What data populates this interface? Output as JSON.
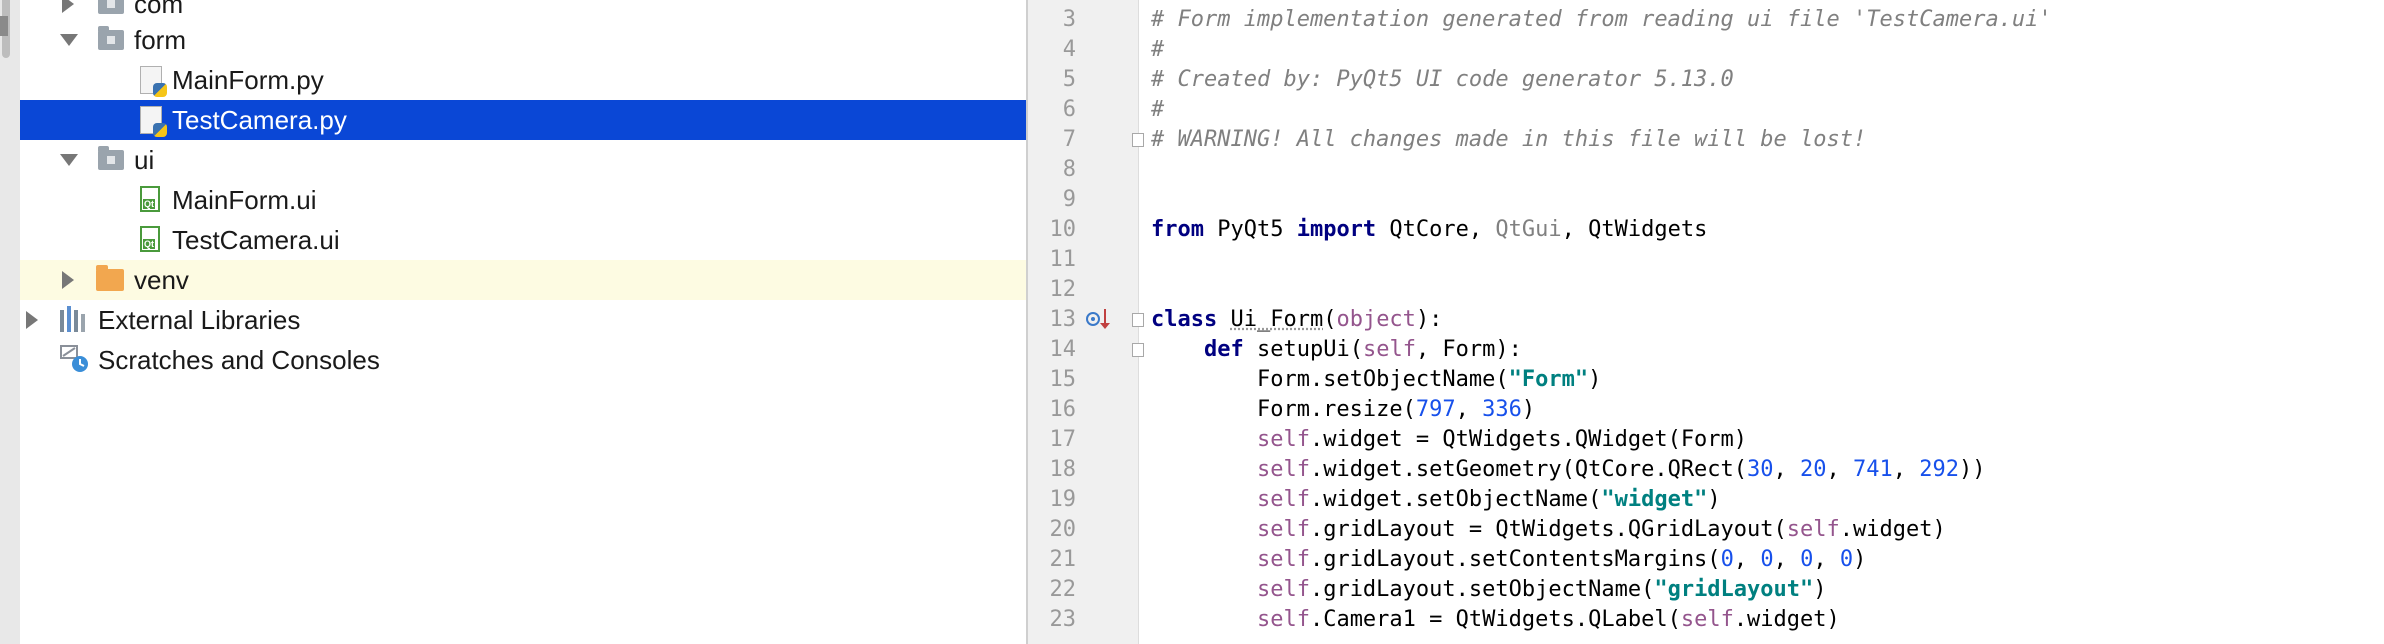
{
  "project_tree": {
    "rows": [
      {
        "id": "com",
        "label": "com",
        "type": "folder",
        "expanded": false
      },
      {
        "id": "form",
        "label": "form",
        "type": "folder",
        "expanded": true
      },
      {
        "id": "mainform-py",
        "label": "MainForm.py",
        "type": "python-file"
      },
      {
        "id": "testcamera-py",
        "label": "TestCamera.py",
        "type": "python-file",
        "selected": true
      },
      {
        "id": "ui",
        "label": "ui",
        "type": "folder",
        "expanded": true
      },
      {
        "id": "mainform-ui",
        "label": "MainForm.ui",
        "type": "qt-ui-file"
      },
      {
        "id": "testcamera-ui",
        "label": "TestCamera.ui",
        "type": "qt-ui-file"
      },
      {
        "id": "venv",
        "label": "venv",
        "type": "excluded-folder",
        "expanded": false
      },
      {
        "id": "external-libraries",
        "label": "External Libraries",
        "type": "libraries",
        "expanded": false
      },
      {
        "id": "scratches",
        "label": "Scratches and Consoles",
        "type": "scratches"
      }
    ]
  },
  "editor": {
    "lines": [
      {
        "n": "3",
        "tokens": [
          [
            "com",
            "# Form implementation generated from reading ui file 'TestCamera.ui'"
          ]
        ]
      },
      {
        "n": "4",
        "tokens": [
          [
            "com",
            "#"
          ]
        ]
      },
      {
        "n": "5",
        "tokens": [
          [
            "com",
            "# Created by: PyQt5 UI code generator 5.13.0"
          ]
        ]
      },
      {
        "n": "6",
        "tokens": [
          [
            "com",
            "#"
          ]
        ]
      },
      {
        "n": "7",
        "tokens": [
          [
            "com",
            "# WARNING! All changes made in this file will be lost!"
          ]
        ],
        "fold": true
      },
      {
        "n": "8",
        "tokens": []
      },
      {
        "n": "9",
        "tokens": []
      },
      {
        "n": "10",
        "tokens": [
          [
            "kw",
            "from"
          ],
          [
            "",
            " PyQt5 "
          ],
          [
            "kw",
            "import"
          ],
          [
            "",
            " QtCore, "
          ],
          [
            "gray",
            "QtGui"
          ],
          [
            "",
            ", QtWidgets"
          ]
        ]
      },
      {
        "n": "11",
        "tokens": []
      },
      {
        "n": "12",
        "tokens": []
      },
      {
        "n": "13",
        "tokens": [
          [
            "kw",
            "class"
          ],
          [
            "",
            " "
          ],
          [
            "und",
            "Ui_Form"
          ],
          [
            "",
            "("
          ],
          [
            "self",
            "object"
          ],
          [
            "",
            "):"
          ]
        ],
        "fold": true,
        "run": true
      },
      {
        "n": "14",
        "tokens": [
          [
            "",
            "    "
          ],
          [
            "kw",
            "def"
          ],
          [
            "",
            " setupUi("
          ],
          [
            "self",
            "self"
          ],
          [
            "",
            ", Form):"
          ]
        ],
        "fold": true
      },
      {
        "n": "15",
        "tokens": [
          [
            "",
            "        Form.setObjectName("
          ],
          [
            "str",
            "\"Form\""
          ],
          [
            "",
            ")"
          ]
        ]
      },
      {
        "n": "16",
        "tokens": [
          [
            "",
            "        Form.resize("
          ],
          [
            "num",
            "797"
          ],
          [
            "",
            ", "
          ],
          [
            "num",
            "336"
          ],
          [
            "",
            ")"
          ]
        ]
      },
      {
        "n": "17",
        "tokens": [
          [
            "",
            "        "
          ],
          [
            "self",
            "self"
          ],
          [
            "",
            ".widget = QtWidgets.QWidget(Form)"
          ]
        ]
      },
      {
        "n": "18",
        "tokens": [
          [
            "",
            "        "
          ],
          [
            "self",
            "self"
          ],
          [
            "",
            ".widget.setGeometry(QtCore.QRect("
          ],
          [
            "num",
            "30"
          ],
          [
            "",
            ", "
          ],
          [
            "num",
            "20"
          ],
          [
            "",
            ", "
          ],
          [
            "num",
            "741"
          ],
          [
            "",
            ", "
          ],
          [
            "num",
            "292"
          ],
          [
            "",
            "))"
          ]
        ]
      },
      {
        "n": "19",
        "tokens": [
          [
            "",
            "        "
          ],
          [
            "self",
            "self"
          ],
          [
            "",
            ".widget.setObjectName("
          ],
          [
            "str",
            "\"widget\""
          ],
          [
            "",
            ")"
          ]
        ]
      },
      {
        "n": "20",
        "tokens": [
          [
            "",
            "        "
          ],
          [
            "self",
            "self"
          ],
          [
            "",
            ".gridLayout = QtWidgets.QGridLayout("
          ],
          [
            "self",
            "self"
          ],
          [
            "",
            ".widget)"
          ]
        ]
      },
      {
        "n": "21",
        "tokens": [
          [
            "",
            "        "
          ],
          [
            "self",
            "self"
          ],
          [
            "",
            ".gridLayout.setContentsMargins("
          ],
          [
            "num",
            "0"
          ],
          [
            "",
            ", "
          ],
          [
            "num",
            "0"
          ],
          [
            "",
            ", "
          ],
          [
            "num",
            "0"
          ],
          [
            "",
            ", "
          ],
          [
            "num",
            "0"
          ],
          [
            "",
            ")"
          ]
        ]
      },
      {
        "n": "22",
        "tokens": [
          [
            "",
            "        "
          ],
          [
            "self",
            "self"
          ],
          [
            "",
            ".gridLayout.setObjectName("
          ],
          [
            "str",
            "\"gridLayout\""
          ],
          [
            "",
            ")"
          ]
        ]
      },
      {
        "n": "23",
        "tokens": [
          [
            "",
            "        "
          ],
          [
            "self",
            "self"
          ],
          [
            "",
            ".Camera1 = QtWidgets.QLabel("
          ],
          [
            "self",
            "self"
          ],
          [
            "",
            ".widget)"
          ]
        ]
      }
    ]
  }
}
